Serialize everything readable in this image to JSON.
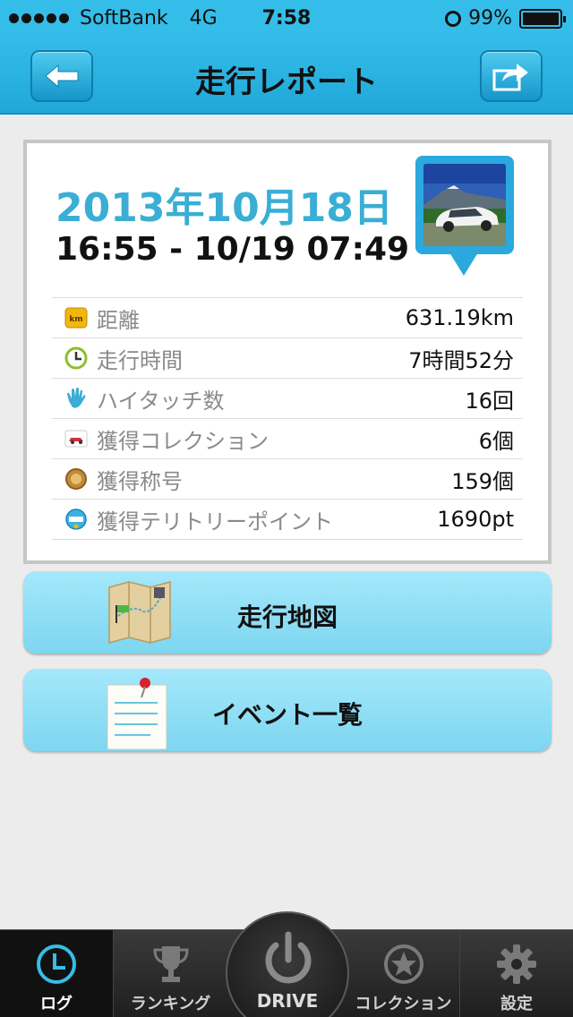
{
  "status_bar": {
    "carrier": "SoftBank",
    "network": "4G",
    "time": "7:58",
    "battery": "99%",
    "battery_level": 0.99
  },
  "navbar": {
    "title": "走行レポート",
    "back_icon": "back-arrow-icon",
    "share_icon": "share-arrow-icon"
  },
  "report": {
    "date": "2013年10月18日",
    "time_range": "16:55 - 10/19 07:49",
    "stats": [
      {
        "icon": "km-icon",
        "label": "距離",
        "value": "631.19km"
      },
      {
        "icon": "clock-icon",
        "label": "走行時間",
        "value": "7時間52分"
      },
      {
        "icon": "high-five-icon",
        "label": "ハイタッチ数",
        "value": "16回"
      },
      {
        "icon": "car-card-icon",
        "label": "獲得コレクション",
        "value": "6個"
      },
      {
        "icon": "medal-icon",
        "label": "獲得称号",
        "value": "159個"
      },
      {
        "icon": "spot-icon",
        "label": "獲得テリトリーポイント",
        "value": "1690pt"
      }
    ]
  },
  "actions": {
    "map_label": "走行地図",
    "events_label": "イベント一覧"
  },
  "tabbar": {
    "log": "ログ",
    "ranking": "ランキング",
    "drive": "DRIVE",
    "collection": "コレクション",
    "settings": "設定",
    "active": "log"
  },
  "colors": {
    "accent": "#35bde9",
    "date_text": "#3aaed4",
    "button_bg": "#8ddcf4"
  }
}
